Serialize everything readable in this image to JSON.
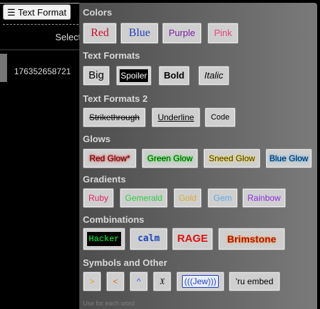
{
  "toolbar": {
    "text_format_label": "☰ Text Format"
  },
  "background": {
    "select_text": "Select",
    "number_text": "176352658721"
  },
  "sections": {
    "colors": "Colors",
    "text_formats": "Text Formats",
    "text_formats_2": "Text Formats 2",
    "glows": "Glows",
    "gradients": "Gradients",
    "combinations": "Combinations",
    "symbols": "Symbols and Other"
  },
  "buttons": {
    "red": "Red",
    "blue": "Blue",
    "purple": "Purple",
    "pink": "Pink",
    "big": "Big",
    "spoiler": "Spoiler",
    "bold": "Bold",
    "italic": "Italic",
    "strikethrough": "Strikethrough",
    "underline": "Underline",
    "code": "Code",
    "red_glow": "Red Glow*",
    "green_glow": "Green Glow",
    "sneed_glow": "Sneed Glow",
    "blue_glow": "Blue Glow",
    "ruby": "Ruby",
    "gemerald": "Gemerald",
    "gold": "Gold",
    "gem": "Gem",
    "rainbow": "Rainbow",
    "hacker": "Hacker",
    "calm": "calm",
    "rage": "RAGE",
    "brimstone": "Brimstone",
    "sym_gt": ">",
    "sym_lt": "<",
    "sym_caret": "^",
    "sym_goth": "𝔛",
    "jew": "(((Jew)))",
    "ru_embed": "'ru embed"
  },
  "hint": "Use for each word",
  "colors": {
    "red": "#c8102e",
    "blue": "#1f3fbf",
    "purple": "#7b1fa2",
    "pink": "#e8457f",
    "hacker": "#00ff41",
    "calm": "#1a47b8",
    "rage": "#e01010",
    "brimstone": "#b01010"
  }
}
